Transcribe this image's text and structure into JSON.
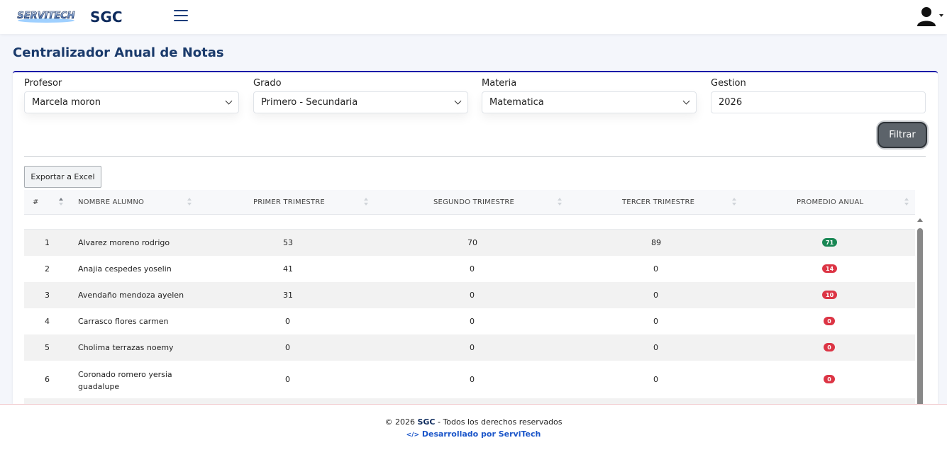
{
  "header": {
    "logo_text": "SERVITECH",
    "brand": "SGC"
  },
  "page": {
    "title": "Centralizador Anual de Notas"
  },
  "filters": {
    "profesor": {
      "label": "Profesor",
      "value": "Marcela moron"
    },
    "grado": {
      "label": "Grado",
      "value": "Primero - Secundaria"
    },
    "materia": {
      "label": "Materia",
      "value": "Matematica"
    },
    "gestion": {
      "label": "Gestion",
      "value": "2026"
    },
    "filter_button": "Filtrar"
  },
  "export_button": "Exportar a Excel",
  "table": {
    "columns": [
      "#",
      "NOMBRE ALUMNO",
      "PRIMER TRIMESTRE",
      "SEGUNDO TRIMESTRE",
      "TERCER TRIMESTRE",
      "PROMEDIO ANUAL"
    ],
    "rows": [
      {
        "num": "1",
        "name": "Alvarez moreno rodrigo",
        "t1": "53",
        "t2": "70",
        "t3": "89",
        "avg": "71",
        "status": "green"
      },
      {
        "num": "2",
        "name": "Anajia cespedes yoselin",
        "t1": "41",
        "t2": "0",
        "t3": "0",
        "avg": "14",
        "status": "red"
      },
      {
        "num": "3",
        "name": "Avendaño mendoza ayelen",
        "t1": "31",
        "t2": "0",
        "t3": "0",
        "avg": "10",
        "status": "red"
      },
      {
        "num": "4",
        "name": "Carrasco flores carmen",
        "t1": "0",
        "t2": "0",
        "t3": "0",
        "avg": "0",
        "status": "red"
      },
      {
        "num": "5",
        "name": "Cholima terrazas noemy",
        "t1": "0",
        "t2": "0",
        "t3": "0",
        "avg": "0",
        "status": "red"
      },
      {
        "num": "6",
        "name": "Coronado romero yersia guadalupe",
        "t1": "0",
        "t2": "0",
        "t3": "0",
        "avg": "0",
        "status": "red"
      }
    ]
  },
  "footer": {
    "copyright_prefix": "© 2026 ",
    "copyright_brand": "SGC",
    "copyright_suffix": " - Todos los derechos reservados",
    "developer_icon": "</>",
    "developer": "Desarrollado por ServiTech"
  },
  "colors": {
    "accent_navy": "#0d2a5c",
    "card_border": "#1a1aa8",
    "badge_green": "#198754",
    "badge_red": "#dc3545",
    "link_blue": "#1a55c9"
  }
}
